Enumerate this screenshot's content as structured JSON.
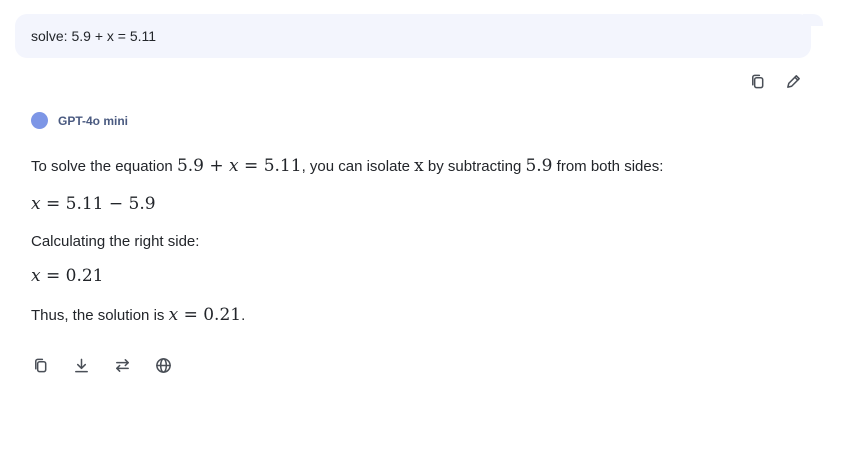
{
  "user_message": {
    "text": "solve: 5.9 + x = 5.11"
  },
  "user_actions": {
    "copy_icon": "copy-icon",
    "edit_icon": "edit-icon"
  },
  "model": {
    "name": "GPT-4o mini",
    "dot_color": "#7d96e6"
  },
  "answer": {
    "line1": {
      "prefix": "To solve the equation ",
      "eq_a": "5.9",
      "plus": " + ",
      "var": "x",
      "eq": " = ",
      "eq_b": "5.11",
      "mid": ", you can isolate ",
      "var2": "x",
      "mid2": " by subtracting ",
      "num": "5.9",
      "suffix": " from both sides:"
    },
    "line2": {
      "var": "x",
      "rest": " = 5.11 − 5.9"
    },
    "line3": {
      "text": "Calculating the right side:"
    },
    "line4": {
      "var": "x",
      "rest": " = 0.21"
    },
    "line5": {
      "prefix": "Thus, the solution is ",
      "var": "x",
      "rest": " = 0.21",
      "suffix": "."
    }
  },
  "bottom_actions": [
    "copy-icon",
    "download-icon",
    "switch-icon",
    "globe-icon"
  ]
}
